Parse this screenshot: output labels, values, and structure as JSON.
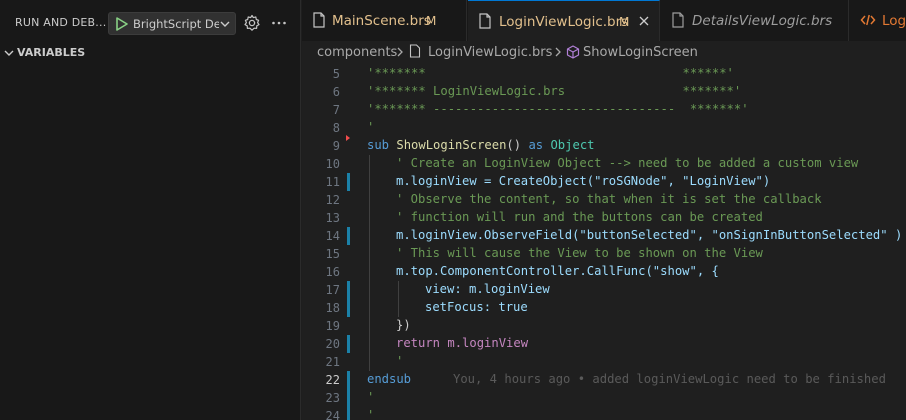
{
  "sidebar": {
    "title": "RUN AND DEB...",
    "debug_config": "BrightScript Del",
    "section": "VARIABLES"
  },
  "tabs": [
    {
      "label": "MainScene.brs",
      "badge": "M"
    },
    {
      "label": "LoginViewLogic.brs",
      "badge": "M"
    },
    {
      "label": "DetailsViewLogic.brs"
    },
    {
      "label": "Logi"
    }
  ],
  "breadcrumb": {
    "folder": "components",
    "file": "LoginViewLogic.brs",
    "symbol": "ShowLoginScreen"
  },
  "editor": {
    "lines": [
      {
        "n": "5",
        "code": "'*******                                   ******'"
      },
      {
        "n": "6",
        "code": "'******* LoginViewLogic.brs                *******'"
      },
      {
        "n": "7",
        "code": "'******* ---------------------------------  *******'"
      },
      {
        "n": "8",
        "code": "'"
      },
      {
        "n": "9",
        "kw": "sub",
        "name": "ShowLoginScreen",
        "rest": "() ",
        "as": "as",
        "type": "Object"
      },
      {
        "n": "10",
        "code": "' Create an LoginView Object --> need to be added a custom view"
      },
      {
        "n": "11",
        "code": "m.loginView = CreateObject(\"roSGNode\", \"LoginView\")"
      },
      {
        "n": "12",
        "code": "' Observe the content, so that when it is set the callback"
      },
      {
        "n": "13",
        "code": "' function will run and the buttons can be created"
      },
      {
        "n": "14",
        "code": "m.loginView.ObserveField(\"buttonSelected\", \"onSignInButtonSelected\" )"
      },
      {
        "n": "15",
        "code": "' This will cause the View to be shown on the View"
      },
      {
        "n": "16",
        "code": "m.top.ComponentController.CallFunc(\"show\", {"
      },
      {
        "n": "17",
        "code": "view: m.loginView"
      },
      {
        "n": "18",
        "code": "setFocus: true"
      },
      {
        "n": "19",
        "code": "})"
      },
      {
        "n": "20",
        "code": "return m.loginView"
      },
      {
        "n": "21",
        "code": "'"
      },
      {
        "n": "22",
        "code": "endsub",
        "blame": "You, 4 hours ago • added loginViewLogic need to be finished"
      },
      {
        "n": "23",
        "code": "'"
      },
      {
        "n": "24",
        "code": "'"
      }
    ]
  },
  "colors": {
    "accent": "#0078d4",
    "modified": "#e2c08d",
    "gutter_modified": "#1b81a8"
  }
}
